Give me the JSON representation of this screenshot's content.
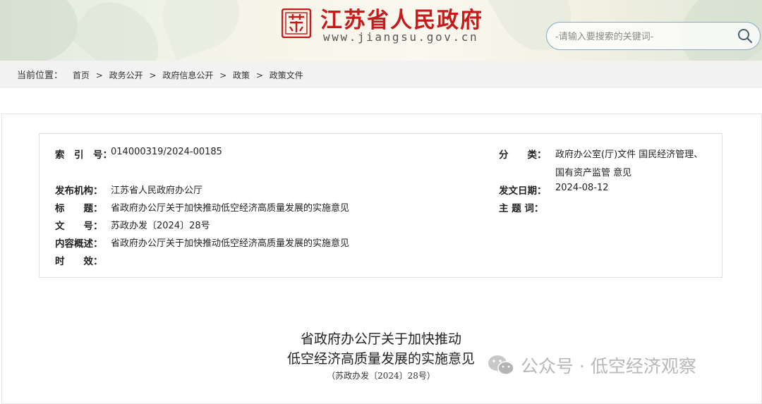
{
  "header": {
    "site_title": "江苏省人民政府",
    "site_url": "www.jiangsu.gov.cn",
    "logo_text": "苏",
    "search_placeholder": "-请输入要搜索的关键词-"
  },
  "breadcrumb": {
    "label": "当前位置：",
    "items": [
      "首页",
      "政务公开",
      "政府信息公开",
      "政策",
      "政策文件"
    ],
    "separator": ">"
  },
  "meta": {
    "index_key": "索　引　号：",
    "index_value": "014000319/2024-00185",
    "category_key": "分　　类：",
    "category_value_line1": "政府办公室(厅)文件 国民经济管理、",
    "category_value_line2": "国有资产监管 意见",
    "publisher_key": "发布机构：",
    "publisher_value": "江苏省人民政府办公厅",
    "date_key": "发文日期：",
    "date_value": "2024-08-12",
    "title_key": "标　　题：",
    "title_value": "省政府办公厅关于加快推动低空经济高质量发展的实施意见",
    "subject_key": "主 题 词：",
    "subject_value": "",
    "docnum_key": "文　　号：",
    "docnum_value": "苏政办发〔2024〕28号",
    "summary_key": "内容概述：",
    "summary_value": "省政府办公厅关于加快推动低空经济高质量发展的实施意见",
    "validity_key": "时　　效：",
    "validity_value": ""
  },
  "document": {
    "title_line1": "省政府办公厅关于加快推动",
    "title_line2": "低空经济高质量发展的实施意见",
    "doc_number": "（苏政办发〔2024〕28号）"
  },
  "watermark": {
    "text": "公众号 · 低空经济观察"
  },
  "colors": {
    "brand_red": "#c81a1a",
    "breadcrumb_bg": "#f2f2f2",
    "search_border": "#8aa8c8"
  }
}
